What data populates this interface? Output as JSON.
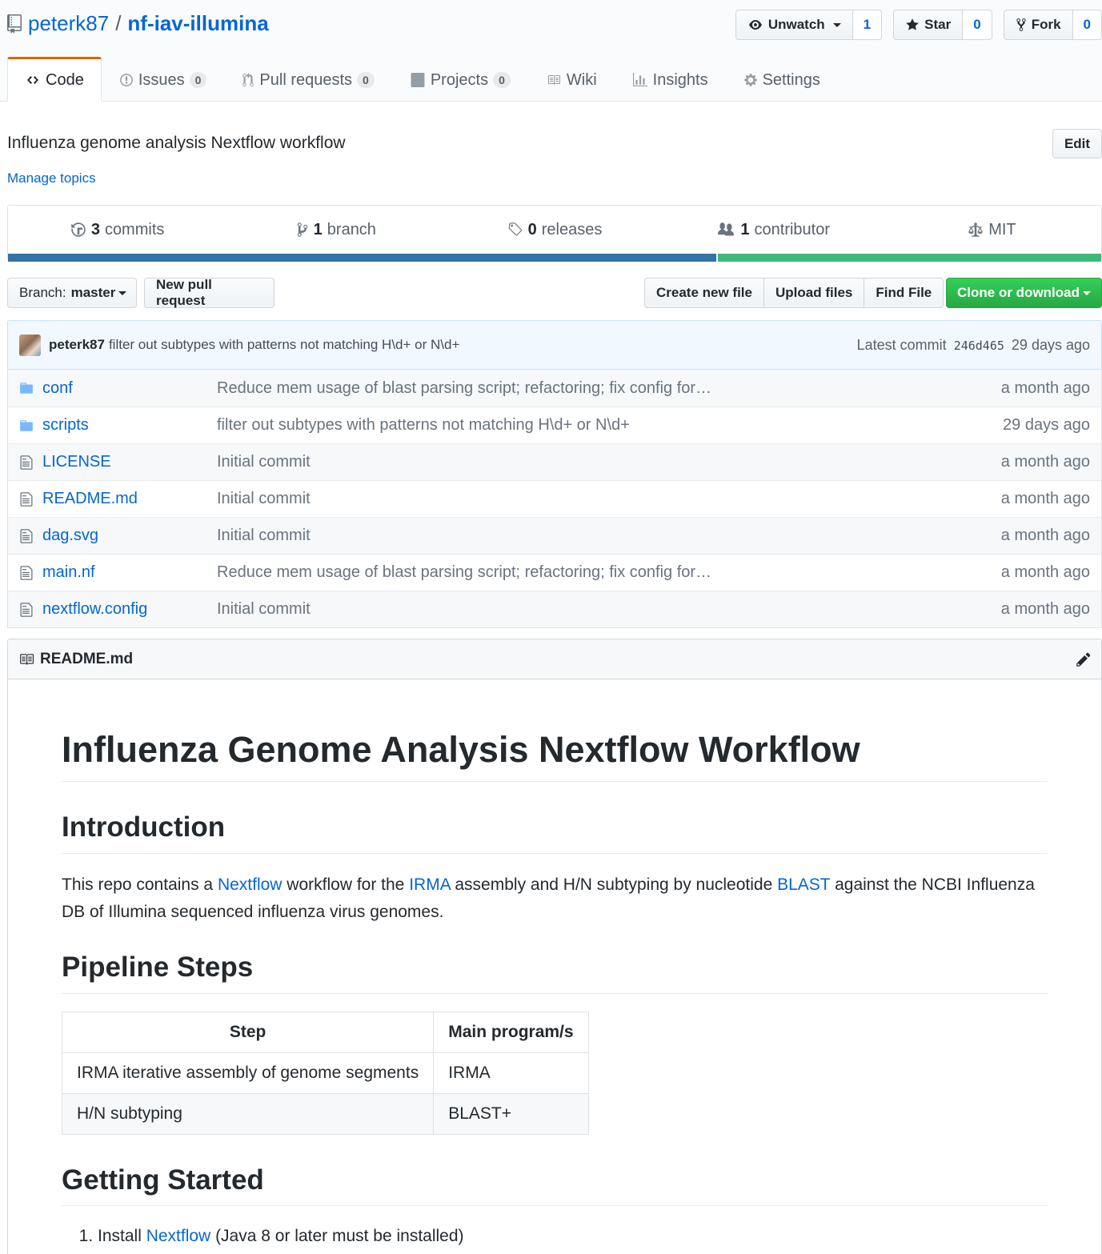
{
  "repo": {
    "owner": "peterk87",
    "separator": "/",
    "name": "nf-iav-illumina"
  },
  "actions": {
    "watch": {
      "label": "Unwatch",
      "count": "1"
    },
    "star": {
      "label": "Star",
      "count": "0"
    },
    "fork": {
      "label": "Fork",
      "count": "0"
    }
  },
  "nav": [
    {
      "label": "Code"
    },
    {
      "label": "Issues",
      "count": "0"
    },
    {
      "label": "Pull requests",
      "count": "0"
    },
    {
      "label": "Projects",
      "count": "0"
    },
    {
      "label": "Wiki"
    },
    {
      "label": "Insights"
    },
    {
      "label": "Settings"
    }
  ],
  "description": "Influenza genome analysis Nextflow workflow",
  "edit_label": "Edit",
  "manage_topics": "Manage topics",
  "summary": {
    "commits": {
      "num": "3",
      "label": "commits"
    },
    "branches": {
      "num": "1",
      "label": "branch"
    },
    "releases": {
      "num": "0",
      "label": "releases"
    },
    "contributors": {
      "num": "1",
      "label": "contributor"
    },
    "license": "MIT"
  },
  "language_colors": {
    "primary": "#3572a5",
    "secondary": "#3fb97a"
  },
  "filenav": {
    "branch_prefix": "Branch:",
    "branch_name": "master",
    "new_pr": "New pull request",
    "create_file": "Create new file",
    "upload": "Upload files",
    "find": "Find File",
    "clone": "Clone or download"
  },
  "latest_commit": {
    "author": "peterk87",
    "message": "filter out subtypes with patterns not matching H\\d+ or N\\d+",
    "prefix": "Latest commit",
    "sha": "246d465",
    "age": "29 days ago"
  },
  "files": [
    {
      "name": "conf",
      "type": "folder",
      "message": "Reduce mem usage of blast parsing script; refactoring; fix config for…",
      "age": "a month ago"
    },
    {
      "name": "scripts",
      "type": "folder",
      "message": "filter out subtypes with patterns not matching H\\d+ or N\\d+",
      "age": "29 days ago"
    },
    {
      "name": "LICENSE",
      "type": "file",
      "message": "Initial commit",
      "age": "a month ago"
    },
    {
      "name": "README.md",
      "type": "file",
      "message": "Initial commit",
      "age": "a month ago"
    },
    {
      "name": "dag.svg",
      "type": "file",
      "message": "Initial commit",
      "age": "a month ago"
    },
    {
      "name": "main.nf",
      "type": "file",
      "message": "Reduce mem usage of blast parsing script; refactoring; fix config for…",
      "age": "a month ago"
    },
    {
      "name": "nextflow.config",
      "type": "file",
      "message": "Initial commit",
      "age": "a month ago"
    }
  ],
  "readme": {
    "filename": "README.md",
    "h1": "Influenza Genome Analysis Nextflow Workflow",
    "intro_heading": "Introduction",
    "intro": {
      "t1": "This repo contains a ",
      "l1": "Nextflow",
      "t2": " workflow for the ",
      "l2": "IRMA",
      "t3": " assembly and H/N subtyping by nucleotide ",
      "l3": "BLAST",
      "t4": " against the NCBI Influenza DB of Illumina sequenced influenza virus genomes."
    },
    "steps_heading": "Pipeline Steps",
    "table": {
      "headers": [
        "Step",
        "Main program/s"
      ],
      "rows": [
        [
          "IRMA iterative assembly of genome segments",
          "IRMA"
        ],
        [
          "H/N subtyping",
          "BLAST+"
        ]
      ]
    },
    "start_heading": "Getting Started",
    "steps_list": [
      {
        "t1": "Install ",
        "link": "Nextflow",
        "t2": " (Java 8 or later must be installed)"
      }
    ]
  }
}
